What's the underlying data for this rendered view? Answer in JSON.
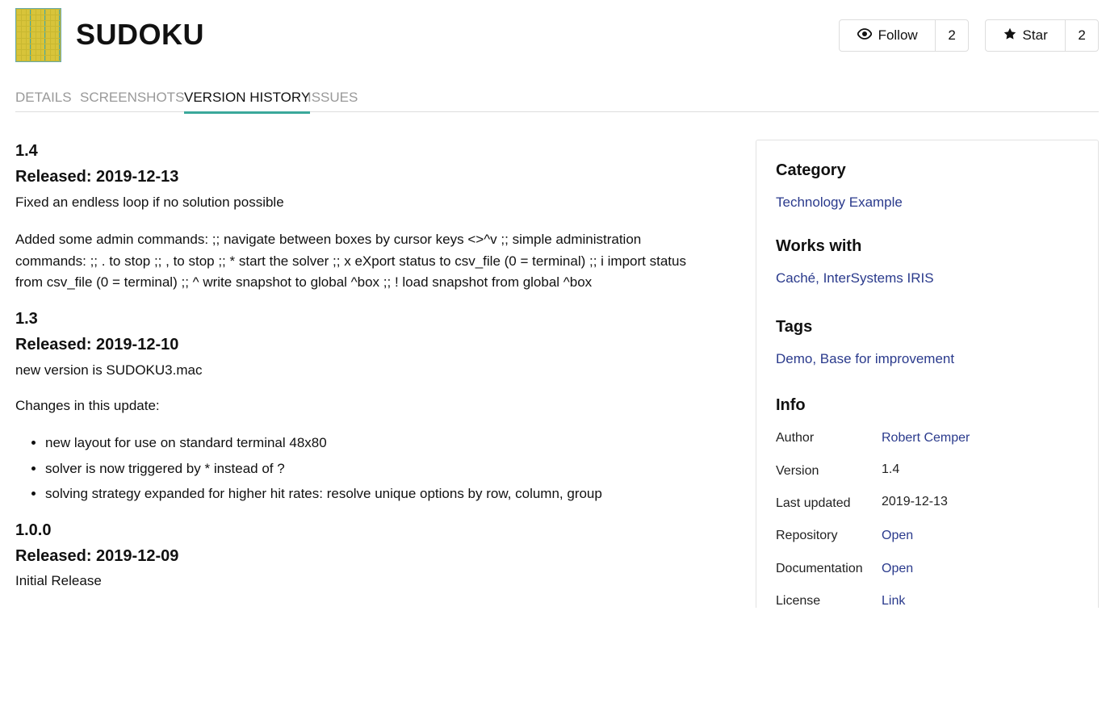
{
  "app": {
    "title": "SUDOKU",
    "follow_label": "Follow",
    "follow_count": "2",
    "star_label": "Star",
    "star_count": "2"
  },
  "tabs": [
    {
      "label": "DETAILS"
    },
    {
      "label": "SCREENSHOTS"
    },
    {
      "label": "VERSION HISTORY",
      "active": true
    },
    {
      "label": "ISSUES"
    }
  ],
  "versions": [
    {
      "version": "1.4",
      "released": "Released: 2019-12-13",
      "p1": "Fixed an endless loop if no solution possible",
      "p2_line1": "Added some admin commands: ;; navigate between boxes by cursor keys <>^v ;; simple administration",
      "p2_line2": "commands: ;; . to stop ;; , to stop ;; * start the solver ;; x eXport status to csv_file (0 = terminal) ;; i import status",
      "p2_line3": "from csv_file (0 = terminal) ;; ^ write snapshot to global ^box ;; ! load snapshot from global ^box"
    },
    {
      "version": "1.3",
      "released": "Released: 2019-12-10",
      "p1": "new version is SUDOKU3.mac",
      "p2": "Changes in this update:",
      "items": [
        "new layout for use on standard terminal 48x80",
        "solver is now triggered by * instead of ?",
        "solving strategy expanded for higher hit rates: resolve unique options by row, column, group"
      ]
    },
    {
      "version": "1.0.0",
      "released": "Released: 2019-12-09",
      "p1": "Initial Release"
    }
  ],
  "sidebar": {
    "category_heading": "Category",
    "category_value": "Technology Example",
    "works_heading": "Works with",
    "works_value": "Caché, InterSystems IRIS",
    "tags_heading": "Tags",
    "tags_value": "Demo, Base for improvement",
    "info_heading": "Info",
    "info": [
      {
        "label": "Author",
        "value": "Robert Cemper",
        "link": true
      },
      {
        "label": "Version",
        "value": "1.4",
        "link": false
      },
      {
        "label": "Last updated",
        "value": "2019-12-13",
        "link": false
      },
      {
        "label": "Repository",
        "value": "Open",
        "link": true
      },
      {
        "label": "Documentation",
        "value": "Open",
        "link": true
      },
      {
        "label": "License",
        "value": "Link",
        "link": true
      }
    ]
  },
  "colors": {
    "accent": "#3aa89a",
    "link": "#2a3a8c"
  }
}
